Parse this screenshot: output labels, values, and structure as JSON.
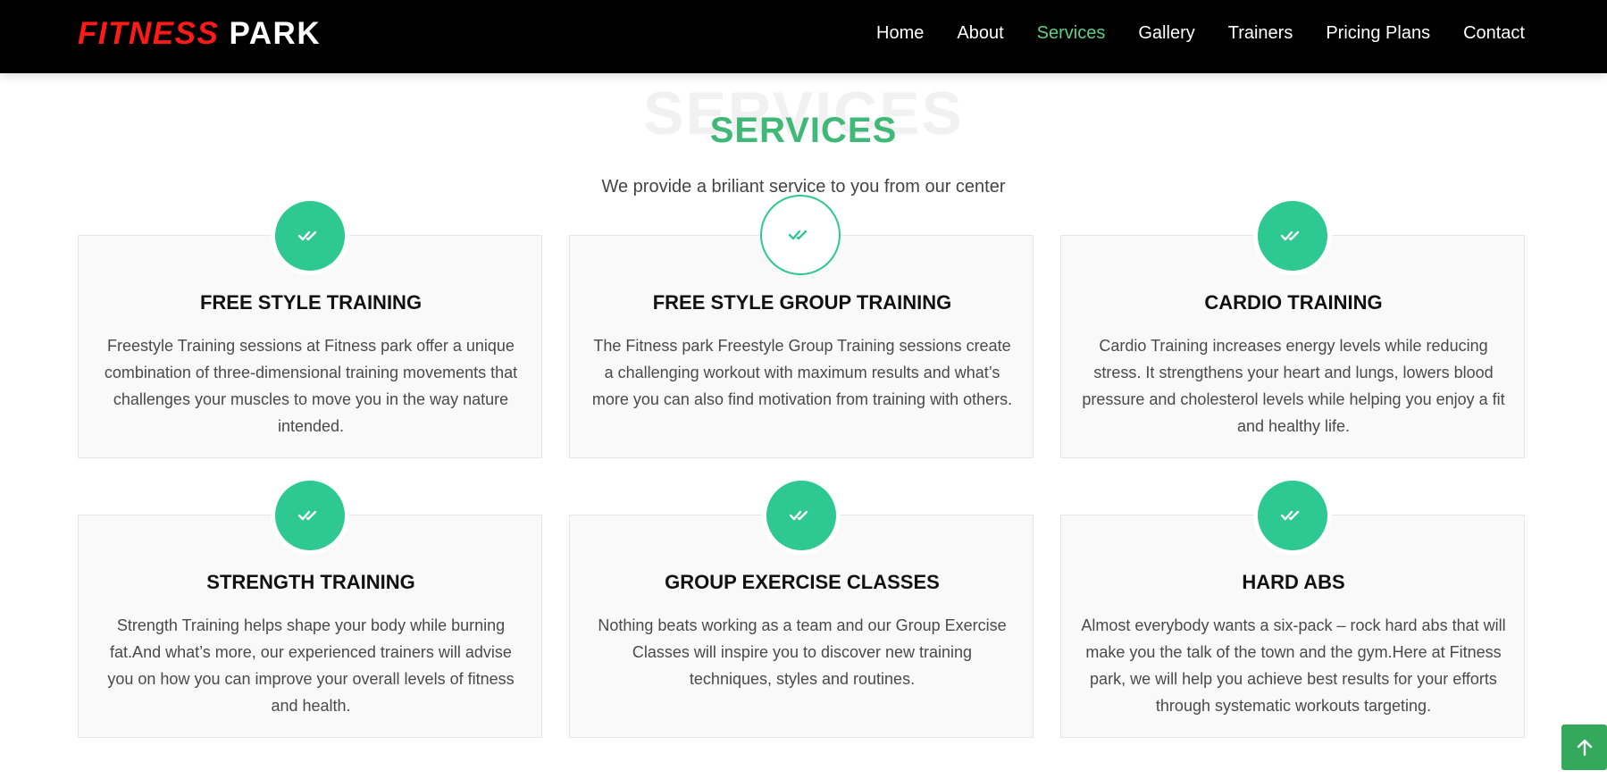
{
  "brand": {
    "part1": "FITNESS",
    "part2": "PARK"
  },
  "nav": [
    {
      "label": "Home"
    },
    {
      "label": "About"
    },
    {
      "label": "Services"
    },
    {
      "label": "Gallery"
    },
    {
      "label": "Trainers"
    },
    {
      "label": "Pricing Plans"
    },
    {
      "label": "Contact"
    }
  ],
  "active_nav": "Services",
  "section": {
    "bg_word": "SERVICES",
    "title": "SERVICES",
    "subtitle": "We provide a briliant service to you from our center"
  },
  "services": [
    {
      "title": "FREE STYLE TRAINING",
      "text": "Freestyle Training sessions at Fitness park offer a unique combination of three-dimensional training movements that challenges your muscles to move you in the way nature intended.",
      "icon": "double-check-icon"
    },
    {
      "title": "FREE STYLE GROUP TRAINING",
      "text": "The Fitness park Freestyle Group Training sessions create a challenging workout with maximum results and what’s more you can also find motivation from training with others.",
      "icon": "double-check-icon"
    },
    {
      "title": "CARDIO TRAINING",
      "text": "Cardio Training increases energy levels while reducing stress. It strengthens your heart and lungs, lowers blood pressure and cholesterol levels while helping you enjoy a fit and healthy life.",
      "icon": "double-check-icon"
    },
    {
      "title": "STRENGTH TRAINING",
      "text": "Strength Training helps shape your body while burning fat.And what’s more, our experienced trainers will advise you on how you can improve your overall levels of fitness and health.",
      "icon": "double-check-icon"
    },
    {
      "title": "GROUP EXERCISE CLASSES",
      "text": "Nothing beats working as a team and our Group Exercise Classes will inspire you to discover new training techniques, styles and routines.",
      "icon": "double-check-icon"
    },
    {
      "title": "HARD ABS",
      "text": "Almost everybody wants a six-pack – rock hard abs that will make you the talk of the town and the gym.Here at Fitness park, we will help you achieve best results for your efforts through systematic workouts targeting.",
      "icon": "double-check-icon"
    }
  ],
  "colors": {
    "accent": "#2ec893",
    "brand_red": "#ff1a1a",
    "title_green": "#40b877",
    "active_nav": "#5fcf86",
    "scroll_top": "#34a95c"
  },
  "scroll_top_icon": "arrow-up-icon"
}
